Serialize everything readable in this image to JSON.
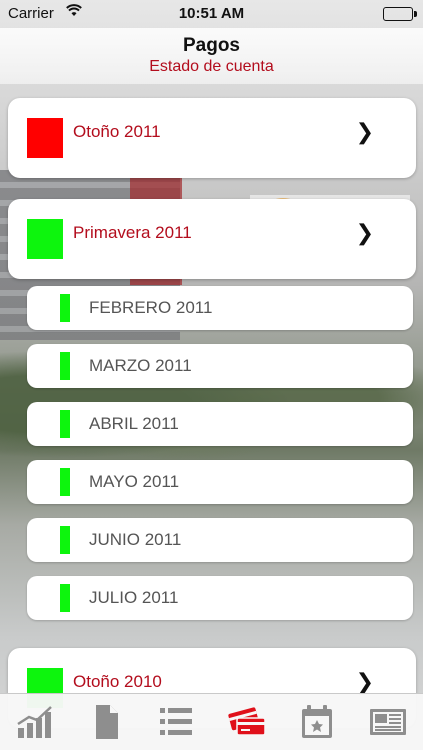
{
  "status_bar": {
    "carrier": "Carrier",
    "wifi_icon": "wifi-icon",
    "time": "10:51 AM",
    "battery_icon": "battery-icon"
  },
  "header": {
    "title": "Pagos",
    "subtitle": "Estado de cuenta"
  },
  "colors": {
    "accent": "#b30d1d",
    "status_red": "#ff0000",
    "status_green": "#0df50d",
    "tab_active": "#e0101a",
    "tab_inactive": "#8e8e8e"
  },
  "periods": [
    {
      "label": "Otoño 2011",
      "status_color": "#ff0000",
      "chevron_icon": "chevron-right-icon"
    },
    {
      "label": "Primavera 2011",
      "status_color": "#0df50d",
      "chevron_icon": "chevron-right-icon"
    },
    {
      "label": "Otoño 2010",
      "status_color": "#0df50d",
      "chevron_icon": "chevron-right-icon"
    }
  ],
  "months": [
    {
      "label": "FEBRERO 2011",
      "status_color": "#0df50d"
    },
    {
      "label": "MARZO 2011",
      "status_color": "#0df50d"
    },
    {
      "label": "ABRIL 2011",
      "status_color": "#0df50d"
    },
    {
      "label": "MAYO 2011",
      "status_color": "#0df50d"
    },
    {
      "label": "JUNIO 2011",
      "status_color": "#0df50d"
    },
    {
      "label": "JULIO 2011",
      "status_color": "#0df50d"
    }
  ],
  "tabs": [
    {
      "icon": "chart-icon",
      "active": false
    },
    {
      "icon": "document-icon",
      "active": false
    },
    {
      "icon": "list-icon",
      "active": false
    },
    {
      "icon": "credit-cards-icon",
      "active": true
    },
    {
      "icon": "calendar-icon",
      "active": false
    },
    {
      "icon": "newspaper-icon",
      "active": false
    }
  ]
}
